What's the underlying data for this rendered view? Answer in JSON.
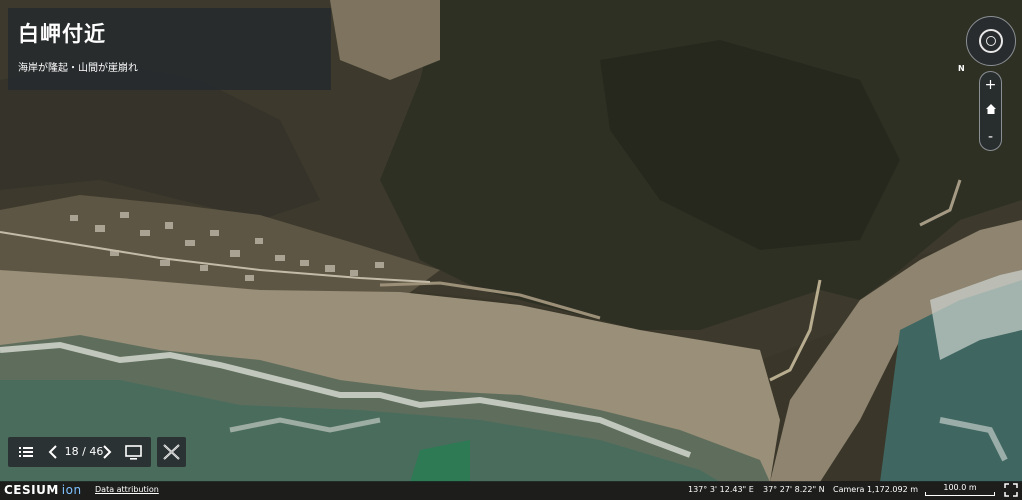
{
  "title": "白岬付近",
  "subtitle": "海岸が隆起・山間が崖崩れ",
  "story": {
    "page": "18 / 46"
  },
  "footer": {
    "logo_text": "CESIUM",
    "logo_suffix": "ion",
    "attribution": "Data attribution",
    "longitude": "137° 3' 12.43\" E",
    "latitude": "37° 27' 8.22\" N",
    "camera": "Camera 1,172.092 m",
    "scale": "100.0 m"
  },
  "navigation": {
    "north": "N",
    "zoom_in": "+",
    "zoom_out": "-"
  },
  "icons": [
    "list-icon",
    "chevron-left-icon",
    "chevron-right-icon",
    "presentation-icon",
    "close-icon",
    "compass-icon",
    "home-icon",
    "fullscreen-icon"
  ]
}
